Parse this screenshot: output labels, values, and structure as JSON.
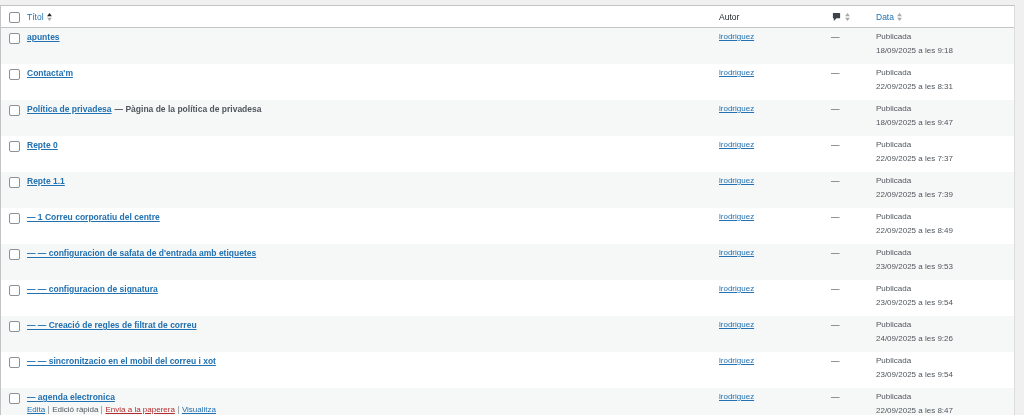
{
  "table": {
    "select_all": {
      "checked": false
    },
    "columns": [
      {
        "label": "Títol",
        "kind": "sortable-link"
      },
      {
        "label": "Autor",
        "kind": "plain"
      },
      {
        "kind": "comments-icon"
      },
      {
        "label": "Data",
        "kind": "sortable-link"
      }
    ],
    "rows": [
      {
        "title": "apuntes",
        "checked": false,
        "author": "lrodriguez",
        "comments": "—",
        "status": "Publicada",
        "date": "18/09/2025 a les 9:18"
      },
      {
        "title": "Contacta'm",
        "checked": false,
        "author": "lrodriguez",
        "comments": "—",
        "status": "Publicada",
        "date": "22/09/2025 a les 8:31"
      },
      {
        "title": "Política de privadesa",
        "post_state": "— Pàgina de la política de privadesa",
        "checked": false,
        "author": "lrodriguez",
        "comments": "—",
        "status": "Publicada",
        "date": "18/09/2025 a les 9:47"
      },
      {
        "title": "Repte 0",
        "checked": false,
        "author": "lrodriguez",
        "comments": "—",
        "status": "Publicada",
        "date": "22/09/2025 a les 7:37"
      },
      {
        "title": "Repte 1.1",
        "checked": false,
        "author": "lrodriguez",
        "comments": "—",
        "status": "Publicada",
        "date": "22/09/2025 a les 7:39"
      },
      {
        "title": "— 1  Correu corporatiu del centre",
        "checked": false,
        "author": "lrodriguez",
        "comments": "—",
        "status": "Publicada",
        "date": "22/09/2025 a les 8:49"
      },
      {
        "title": "— — configuracion de safata de d'entrada amb etiquetes",
        "checked": false,
        "author": "lrodriguez",
        "comments": "—",
        "status": "Publicada",
        "date": "23/09/2025 a les 9:53"
      },
      {
        "title": "— — configuracion de signatura",
        "checked": false,
        "author": "lrodriguez",
        "comments": "—",
        "status": "Publicada",
        "date": "23/09/2025 a les 9:54"
      },
      {
        "title": "— — Creació de regles de filtrat de correu",
        "checked": false,
        "author": "lrodriguez",
        "comments": "—",
        "status": "Publicada",
        "date": "24/09/2025 a les 9:26"
      },
      {
        "title": "— — sincronitzacio en el mobil del correu i xot",
        "checked": false,
        "author": "lrodriguez",
        "comments": "—",
        "status": "Publicada",
        "date": "23/09/2025 a les 9:54"
      },
      {
        "title": "— agenda electronica",
        "checked": false,
        "author": "lrodriguez",
        "comments": "—",
        "status": "Publicada",
        "date": "22/09/2025 a les 8:47",
        "actions": [
          {
            "label": "Edita",
            "kind": "link"
          },
          {
            "label": "Edició ràpida",
            "kind": "button"
          },
          {
            "label": "Envia a la paperera",
            "kind": "delete"
          },
          {
            "label": "Visualitza",
            "kind": "link"
          }
        ]
      }
    ]
  }
}
